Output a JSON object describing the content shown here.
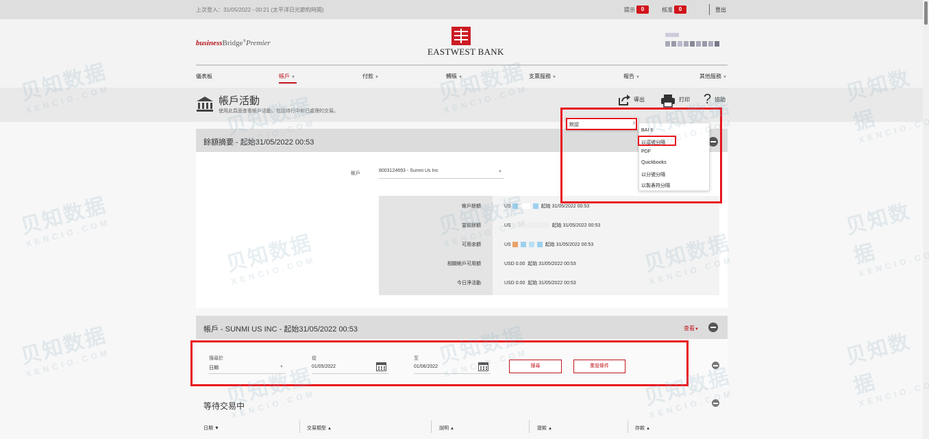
{
  "topbar": {
    "last_login": "上次登入：31/05/2022 - 00:21 (太平洋日光節約時間)",
    "alerts_label": "提示",
    "alerts_count": "0",
    "approvals_label": "核准",
    "approvals_count": "0",
    "logout": "登出"
  },
  "brand": {
    "bb_red": "business",
    "bb_main": "Bridge",
    "bb_reg": "®",
    "bb_prem": "Premier",
    "bank_name": "EASTWEST BANK"
  },
  "nav": {
    "items": [
      "儀表板",
      "帳戶",
      "付款",
      "轉賬",
      "支票服務",
      "報告",
      "其他服務"
    ]
  },
  "page": {
    "title": "帳戶活動",
    "description": "使用此頁面查看帳戶活動，包括待行中和已處理的交易。"
  },
  "tools": {
    "export": "導出",
    "print": "打印",
    "help": "協助",
    "help_glyph": "?"
  },
  "export_menu": {
    "default_label": "默認",
    "options": [
      "BAI II",
      "以逗號分隔",
      "PDF",
      "Quickbooks",
      "以分號分隔",
      "以製表符分隔"
    ]
  },
  "balance_summary": {
    "header": "餘額摘要 - 起始31/05/2022 00:53",
    "account_label": "帳戶",
    "account_value": "8003124693 - Sunmi Us Inc",
    "rows": [
      {
        "label": "帳戶餘額",
        "currency": "US",
        "value": "起始 31/05/2022 00:53"
      },
      {
        "label": "當前餘額",
        "currency": "US",
        "value": "起始 31/05/2022 00:53"
      },
      {
        "label": "可用余額",
        "currency": "US",
        "value": "起始 31/05/2022 00:53"
      },
      {
        "label": "相關帳戶可用額",
        "currency": "USD 0.00",
        "value": "起始 31/05/2022 00:53"
      },
      {
        "label": "今日淨活動",
        "currency": "USD 0.00",
        "value": "起始 31/05/2022 00:53"
      }
    ]
  },
  "account_panel": {
    "header": "帳戶 - SUNMI US INC - 起始31/05/2022 00:53",
    "view_label": "查看",
    "search_in_label": "搜尋於",
    "search_in_value": "日期",
    "from_label": "從",
    "from_value": "01/05/2022",
    "to_label": "至",
    "to_value": "01/06/2022",
    "search_button": "搜尋",
    "reset_button": "重設條件"
  },
  "pending": {
    "title": "等待交易中",
    "columns": [
      "日期",
      "交易類型",
      "說明",
      "提款",
      "存款"
    ]
  },
  "colors": {
    "brand_red": "#cc1b24",
    "highlight_red": "#e8141c",
    "badge_red": "#d2141b"
  },
  "watermark": {
    "cn": "贝知数据",
    "en": "XENCIO.COM"
  }
}
